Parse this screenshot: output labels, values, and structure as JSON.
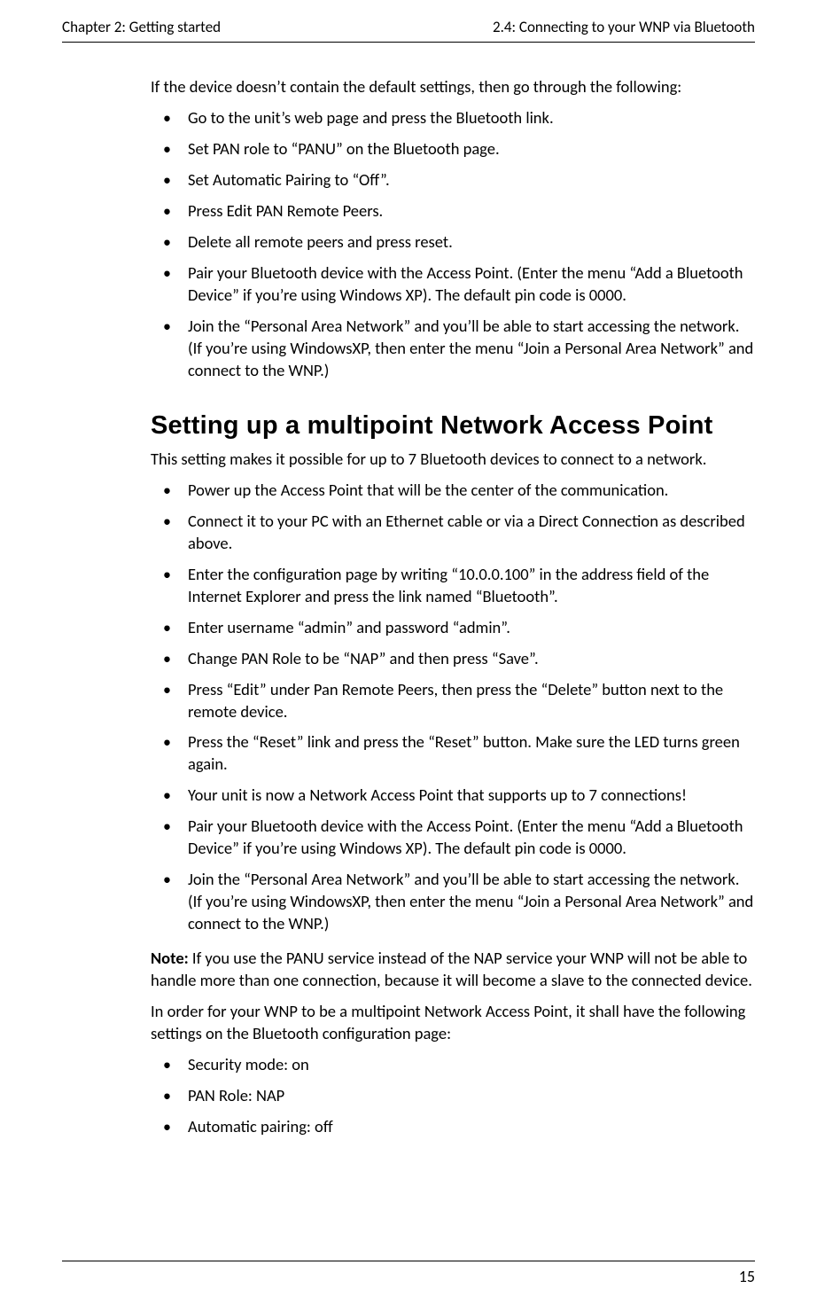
{
  "header": {
    "left": "Chapter 2: Getting started",
    "right": "2.4: Connecting to your WNP via Bluetooth"
  },
  "intro": "If the device doesn’t contain the default settings, then go through the following:",
  "steps1": [
    "Go to the unit’s web page and press the Bluetooth link.",
    "Set PAN role to “PANU” on the Bluetooth page.",
    "Set Automatic Pairing to “Off”.",
    "Press Edit PAN Remote Peers.",
    "Delete all remote peers and press reset.",
    "Pair your Bluetooth device with the Access Point. (Enter the menu “Add a Bluetooth Device” if you’re using Windows XP). The default pin code is 0000.",
    "Join the “Personal Area Network” and you’ll be able to start accessing the network. (If you’re using WindowsXP, then enter the menu “Join a Personal Area Network” and connect to the WNP.)"
  ],
  "section": {
    "title": "Setting up a multipoint Network Access Point",
    "lead": "This setting makes it possible for up to 7 Bluetooth devices to connect to a net­work.",
    "steps": [
      "Power up the Access Point that will be the center of the communication.",
      "Connect it to your PC with an Ethernet cable or via a Direct Connection as de­scribed above.",
      "Enter the configuration page by writing “10.0.0.100” in the address field of the Internet Explorer and press the link named “Bluetooth”.",
      "Enter username “admin” and password “admin”.",
      "Change PAN Role to be “NAP” and then press “Save”.",
      "Press “Edit” under Pan Remote Peers, then press the “Delete” button next to the remote device.",
      "Press the “Reset” link and press the “Reset” button. Make sure the LED turns green again.",
      "Your unit is now a Network Access Point that supports up to 7 connections!",
      "Pair your Bluetooth device with the Access Point. (Enter the menu “Add a Bluetooth Device” if you’re using Windows XP). The default pin code is 0000.",
      "Join the “Personal Area Network” and you’ll be able to start accessing the network. (If you’re using WindowsXP, then enter the menu “Join a Personal Area Network” and connect to the WNP.)"
    ],
    "note_label": "Note:",
    "note_body": " If you use the PANU service instead of the NAP service your WNP will not be able to handle more than one connection, because it will become a slave to the connected device.",
    "settings_intro": "In order for your WNP to be a multipoint Network Access Point, it shall have the following settings on the Bluetooth configuration page:",
    "settings": [
      "Security mode: on",
      "PAN Role: NAP",
      "Automatic pairing: off"
    ]
  },
  "page_number": "15"
}
